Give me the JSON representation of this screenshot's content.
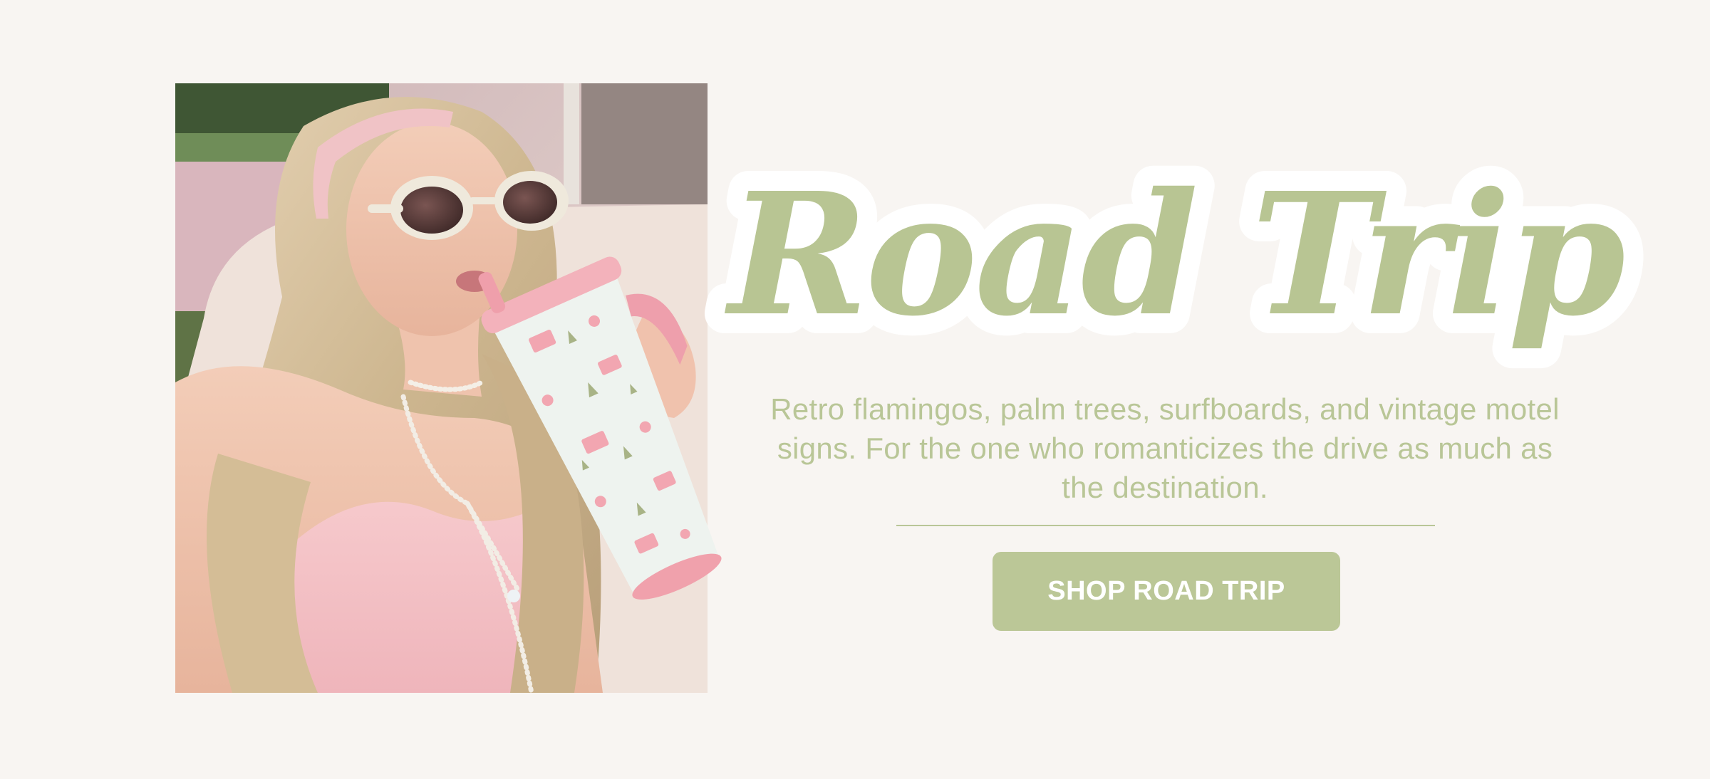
{
  "hero": {
    "headline": "Road Trip",
    "description": "Retro flamingos, palm trees, surfboards, and vintage motel signs. For the one who romanticizes the drive as much as the destination.",
    "cta_label": "SHOP ROAD TRIP"
  },
  "photo": {
    "alt": "Woman in white sunglasses and pink top sipping from a patterned tumbler"
  },
  "colors": {
    "background": "#f8f5f2",
    "accent_green": "#b9c697",
    "button_text": "#ffffff",
    "headline_outline": "#ffffff"
  }
}
